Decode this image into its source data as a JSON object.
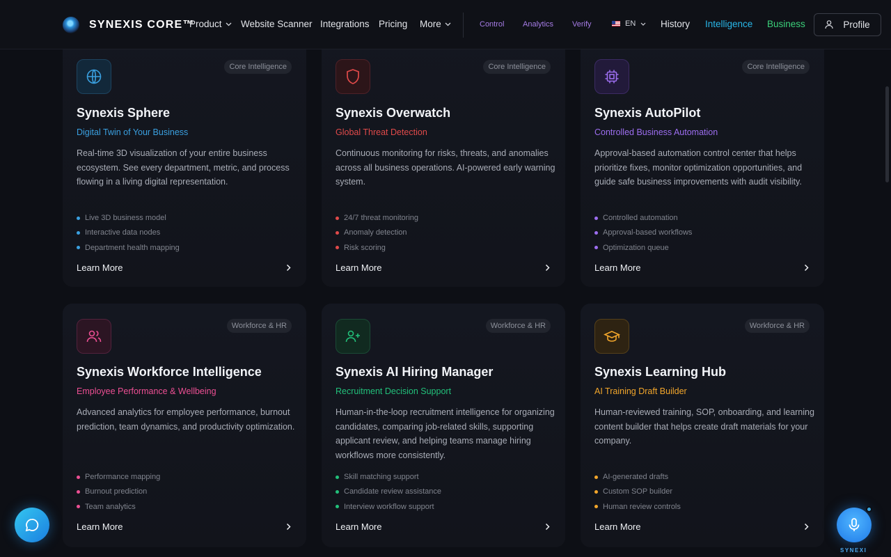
{
  "nav": {
    "brand": "SYNEXIS CORE™",
    "links": [
      "Product",
      "Website Scanner",
      "Integrations",
      "Pricing",
      "More"
    ],
    "small_links": [
      "Control",
      "Analytics",
      "Verify"
    ],
    "language": "EN",
    "history": "History",
    "intelligence": "Intelligence",
    "business": "Business",
    "profile": "Profile"
  },
  "colors": {
    "sky": "#3aa0e0",
    "red": "#e04a4a",
    "purple": "#9d6ef0",
    "pink": "#ec4f93",
    "green": "#22c07a",
    "amber": "#f2a62b",
    "intelligence_link": "#28b7e8",
    "business_link": "#3bd07a"
  },
  "cards": [
    {
      "icon": "globe-icon",
      "category": "Core Intelligence",
      "title": "Synexis Sphere",
      "subtitle": "Digital Twin of Your Business",
      "description": "Real-time 3D visualization of your entire business ecosystem. See every department, metric, and process flowing in a living digital representation.",
      "features": [
        "Live 3D business model",
        "Interactive data nodes",
        "Department health mapping"
      ],
      "cta": "Learn More"
    },
    {
      "icon": "shield-icon",
      "category": "Core Intelligence",
      "title": "Synexis Overwatch",
      "subtitle": "Global Threat Detection",
      "description": "Continuous monitoring for risks, threats, and anomalies across all business operations. AI-powered early warning system.",
      "features": [
        "24/7 threat monitoring",
        "Anomaly detection",
        "Risk scoring"
      ],
      "cta": "Learn More"
    },
    {
      "icon": "cpu-icon",
      "category": "Core Intelligence",
      "title": "Synexis AutoPilot",
      "subtitle": "Controlled Business Automation",
      "description": "Approval-based automation control center that helps prioritize fixes, monitor optimization opportunities, and guide safe business improvements with audit visibility.",
      "features": [
        "Controlled automation",
        "Approval-based workflows",
        "Optimization queue"
      ],
      "cta": "Learn More"
    },
    {
      "icon": "users-icon",
      "category": "Workforce & HR",
      "title": "Synexis Workforce Intelligence",
      "subtitle": "Employee Performance & Wellbeing",
      "description": "Advanced analytics for employee performance, burnout prediction, team dynamics, and productivity optimization.",
      "features": [
        "Performance mapping",
        "Burnout prediction",
        "Team analytics"
      ],
      "cta": "Learn More"
    },
    {
      "icon": "user-plus-icon",
      "category": "Workforce & HR",
      "title": "Synexis AI Hiring Manager",
      "subtitle": "Recruitment Decision Support",
      "description": "Human-in-the-loop recruitment intelligence for organizing candidates, comparing job-related skills, supporting applicant review, and helping teams manage hiring workflows more consistently.",
      "features": [
        "Skill matching support",
        "Candidate review assistance",
        "Interview workflow support"
      ],
      "cta": "Learn More"
    },
    {
      "icon": "graduation-cap-icon",
      "category": "Workforce & HR",
      "title": "Synexis Learning Hub",
      "subtitle": "AI Training Draft Builder",
      "description": "Human-reviewed training, SOP, onboarding, and learning content builder that helps create draft materials for your company.",
      "features": [
        "AI-generated drafts",
        "Custom SOP builder",
        "Human review controls"
      ],
      "cta": "Learn More"
    }
  ],
  "voice_label": "SYNEXI"
}
